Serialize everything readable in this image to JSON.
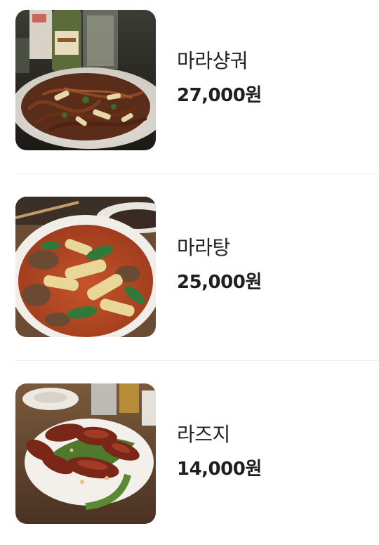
{
  "menu": {
    "items": [
      {
        "name": "마라샹궈",
        "price": "27,000원",
        "image": "malaxiangguo-photo"
      },
      {
        "name": "마라탕",
        "price": "25,000원",
        "image": "malatang-photo"
      },
      {
        "name": "라즈지",
        "price": "14,000원",
        "image": "laziji-photo"
      }
    ]
  }
}
